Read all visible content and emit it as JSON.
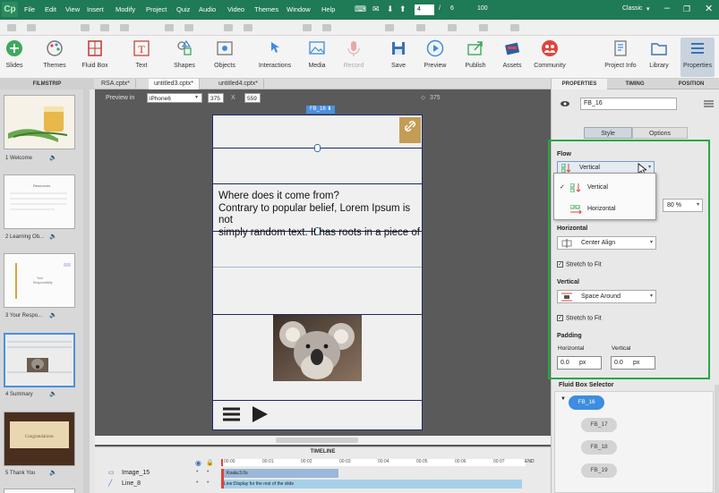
{
  "menubar": {
    "logo": "Cp",
    "items": [
      "File",
      "Edit",
      "View",
      "Insert",
      "Modify",
      "Project",
      "Quiz",
      "Audio",
      "Video",
      "Themes",
      "Window",
      "Help"
    ],
    "slide_current": "4",
    "slide_sep": "/",
    "slide_total": "6",
    "zoom": "100",
    "workspace": "Classic"
  },
  "ribbon": {
    "buttons": [
      "Slides",
      "Themes",
      "Fluid Box",
      "Text",
      "Shapes",
      "Objects",
      "Interactions",
      "Media",
      "Record",
      "Save",
      "Preview",
      "Publish",
      "Assets",
      "Community",
      "Project Info",
      "Library",
      "Properties"
    ]
  },
  "filmstrip": {
    "title": "FILMSTRIP",
    "slides": [
      {
        "label": "1 Welcome"
      },
      {
        "label": "2 Learning Ob..."
      },
      {
        "label": "3 Your Respo..."
      },
      {
        "label": "4 Summary"
      },
      {
        "label": "5 Thank You"
      }
    ],
    "thumb_texts": {
      "s2": "Resources",
      "s3": "Your\nResponsibility",
      "s5": "Congratulations"
    }
  },
  "doc_tabs": [
    "RSA.cptx*",
    "untitled3.cptx*",
    "untitled4.cptx*"
  ],
  "stage": {
    "preview_label": "Preview in",
    "device": "iPhone6",
    "width": "375",
    "x_sep": "X",
    "height": "559",
    "ruler_mark": "375",
    "fluid_box_label": "FB_16",
    "text_lines": [
      "Where does it come from?",
      "Contrary to popular belief, Lorem Ipsum is not",
      "simply random text. It has roots in a piece of"
    ]
  },
  "timeline": {
    "title": "TIMELINE",
    "rows": [
      {
        "name": "Image_15",
        "bar": "Koala:3.0s"
      },
      {
        "name": "Line_8",
        "bar": "Line:Display for the rest of the slide"
      }
    ],
    "ruler": [
      "00:00",
      "00:01",
      "00:02",
      "00:03",
      "00:04",
      "00:05",
      "00:06",
      "00:07"
    ],
    "end_label": "END"
  },
  "properties": {
    "tabs": [
      "PROPERTIES",
      "TIMING",
      "POSITION"
    ],
    "name": "FB_16",
    "subtabs": [
      "Style",
      "Options"
    ],
    "flow": {
      "title": "Flow",
      "selected": "Vertical",
      "options": [
        "Vertical",
        "Horizontal"
      ]
    },
    "percent": "80 %",
    "horizontal": {
      "title": "Horizontal",
      "value": "Center Align",
      "stretch": "Stretch to Fit"
    },
    "vertical": {
      "title": "Vertical",
      "value": "Space Around",
      "stretch": "Stretch to Fit"
    },
    "padding": {
      "title": "Padding",
      "h_label": "Horizontal",
      "v_label": "Vertical",
      "h_value": "0.0",
      "v_value": "0.0",
      "unit": "px"
    },
    "selector": {
      "title": "Fluid Box Selector",
      "items": [
        "FB_16",
        "FB_17",
        "FB_18",
        "FB_19"
      ]
    }
  },
  "colors": {
    "menubar": "#1f7a56",
    "accent_green": "#27a844",
    "selection_blue": "#3d8de0"
  }
}
